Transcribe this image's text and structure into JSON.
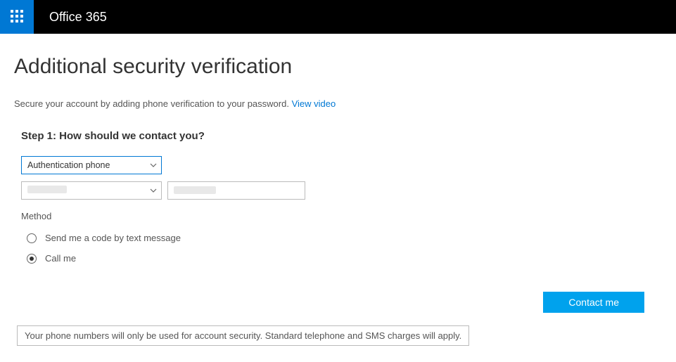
{
  "header": {
    "brand": "Office 365"
  },
  "page": {
    "title": "Additional security verification",
    "description_pre": "Secure your account by adding phone verification to your password. ",
    "view_video": "View video"
  },
  "step": {
    "title": "Step 1: How should we contact you?",
    "contact_method_selected": "Authentication phone",
    "country_selected": "",
    "phone_value": "",
    "method_label": "Method",
    "radio_text": "Send me a code by text message",
    "radio_call": "Call me"
  },
  "actions": {
    "contact_me": "Contact me"
  },
  "notice": "Your phone numbers will only be used for account security. Standard telephone and SMS charges will apply."
}
